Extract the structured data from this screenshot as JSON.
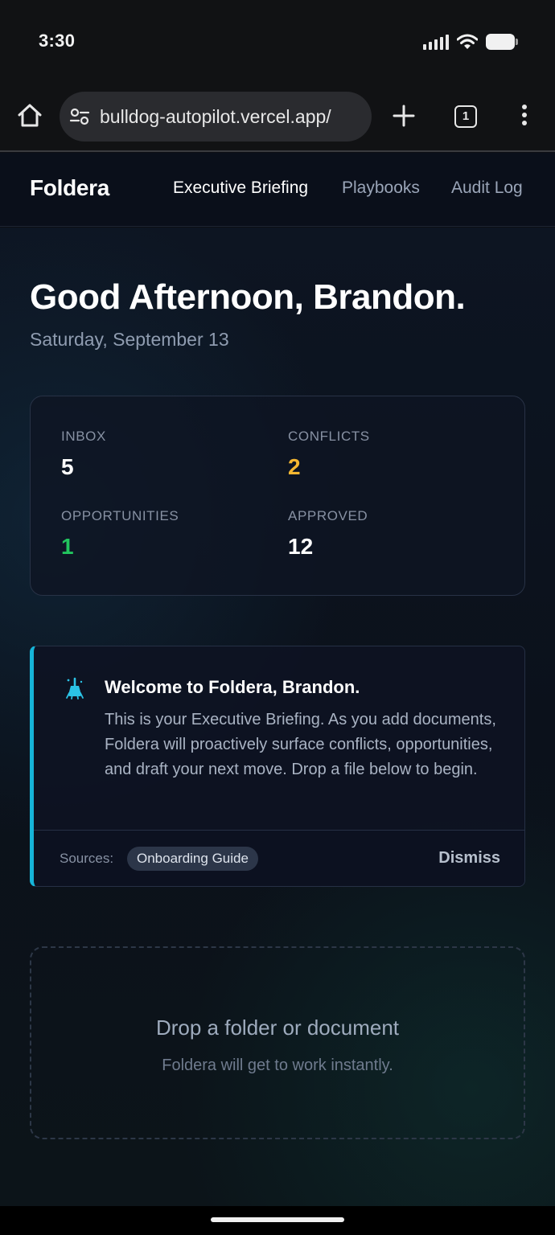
{
  "status_bar": {
    "time": "3:30"
  },
  "browser": {
    "url": "bulldog-autopilot.vercel.app/",
    "tab_count": "1"
  },
  "app": {
    "brand": "Foldera",
    "nav": [
      {
        "label": "Executive Briefing",
        "active": true
      },
      {
        "label": "Playbooks",
        "active": false
      },
      {
        "label": "Audit Log",
        "active": false
      }
    ]
  },
  "greeting": {
    "title": "Good Afternoon, Brandon.",
    "date": "Saturday, September 13"
  },
  "stats": [
    {
      "label": "INBOX",
      "value": "5",
      "color": "#ffffff"
    },
    {
      "label": "CONFLICTS",
      "value": "2",
      "color": "#f5b731"
    },
    {
      "label": "OPPORTUNITIES",
      "value": "1",
      "color": "#22c55e"
    },
    {
      "label": "APPROVED",
      "value": "12",
      "color": "#ffffff"
    }
  ],
  "welcome": {
    "icon": "broom-icon",
    "title": "Welcome to Foldera, Brandon.",
    "body": "This is your Executive Briefing. As you add documents, Foldera will proactively surface conflicts, opportunities, and draft your next move. Drop a file below to begin.",
    "sources_label": "Sources:",
    "source_chip": "Onboarding Guide",
    "dismiss_label": "Dismiss",
    "accent_color": "#16b4d8"
  },
  "dropzone": {
    "title": "Drop a folder or document",
    "subtitle": "Foldera will get to work instantly."
  }
}
